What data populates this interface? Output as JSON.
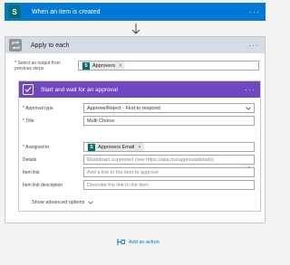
{
  "trigger": {
    "title": "When an item is created",
    "icon": "sharepoint-icon",
    "more": "···"
  },
  "loop": {
    "title": "Apply to each",
    "more": "···",
    "select_label": "* Select an output from previous steps",
    "select_token": "Approvers",
    "token_remove": "×"
  },
  "approval": {
    "title": "Start and wait for an approval",
    "more": "···",
    "fields": {
      "approval_type": {
        "label": "* Approval type",
        "value": "Approve/Reject - First to respond"
      },
      "title": {
        "label": "* Title",
        "value": "Multi Choice"
      },
      "assigned_to": {
        "label": "* Assigned to",
        "token": "Approvers Email",
        "remove": "×"
      },
      "details": {
        "label": "Details",
        "placeholder": "Markdown supported (see https://aka.ms/approvaldetails)"
      },
      "item_link": {
        "label": "Item link",
        "placeholder": "Add a link to the item to approve"
      },
      "item_link_description": {
        "label": "Item link description",
        "placeholder": "Describe the link to the item"
      }
    },
    "show_advanced": "Show advanced options"
  },
  "add_action": "Add an action",
  "colors": {
    "trigger": "#0078d4",
    "sharepoint": "#036c70",
    "approval": "#6f47bf",
    "loop_header": "#d6dce5",
    "link": "#0078d4"
  }
}
